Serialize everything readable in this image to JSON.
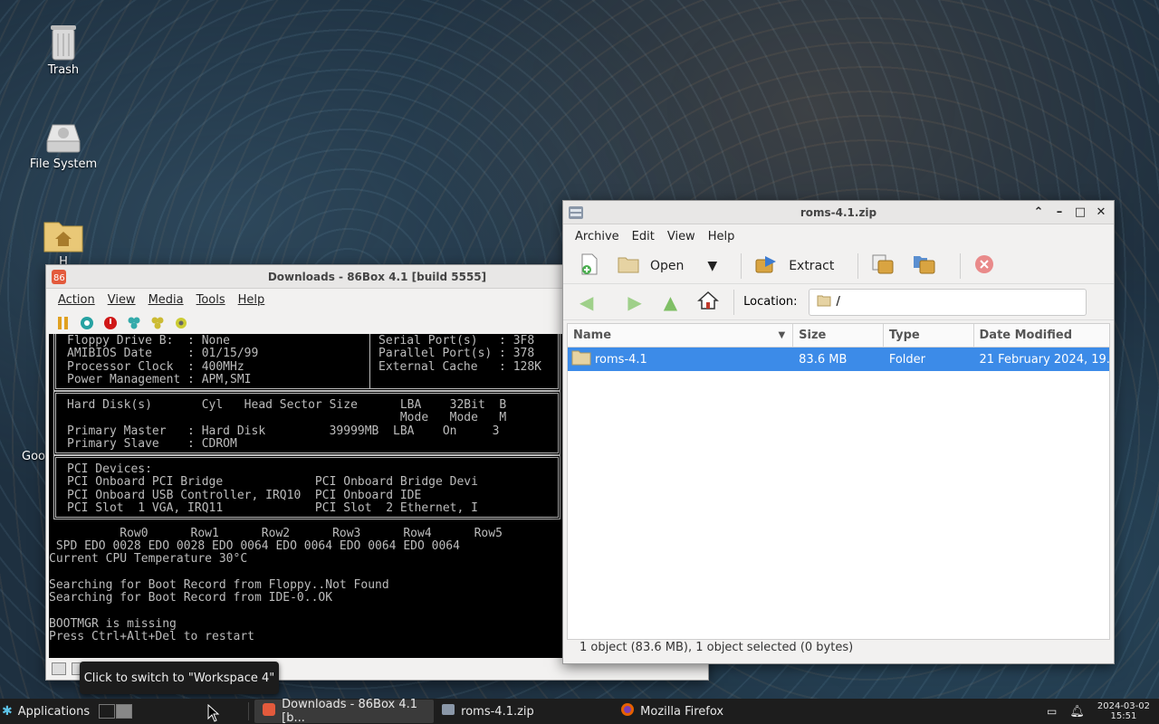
{
  "desktop": {
    "icons": [
      {
        "label": "Trash",
        "icon": "trash-icon"
      },
      {
        "label": "File System",
        "icon": "drive-icon"
      },
      {
        "label": "H",
        "icon": "home-folder-icon"
      },
      {
        "label": "Goo",
        "icon": "app-icon"
      }
    ]
  },
  "box86": {
    "title": "Downloads - 86Box 4.1 [build 5555]",
    "menu": [
      "Action",
      "View",
      "Media",
      "Tools",
      "Help"
    ],
    "toolbar_icons": [
      "pause-icon",
      "reset-icon",
      "power-icon",
      "ctrl-alt-del-icon",
      "ctrl-alt-esc-icon",
      "settings-icon"
    ],
    "screen": {
      "box1_left": "Floppy Drive B:  : None\nAMIBIOS Date     : 01/15/99\nProcessor Clock  : 400MHz\nPower Management : APM,SMI",
      "box1_right": "Serial Port(s)   : 3F8\nParallel Port(s) : 378\nExternal Cache   : 128K",
      "box2": "Hard Disk(s)       Cyl   Head Sector Size      LBA    32Bit  B\n                                               Mode   Mode   M\nPrimary Master   : Hard Disk         39999MB  LBA    On     3\nPrimary Slave    : CDROM",
      "box3": "PCI Devices:\nPCI Onboard PCI Bridge             PCI Onboard Bridge Devi\nPCI Onboard USB Controller, IRQ10  PCI Onboard IDE\nPCI Slot  1 VGA, IRQ11             PCI Slot  2 Ethernet, I",
      "rows_header": "          Row0      Row1      Row2      Row3      Row4      Row5",
      "spd_line": " SPD EDO 0028 EDO 0028 EDO 0064 EDO 0064 EDO 0064 EDO 0064",
      "cpu_temp": "Current CPU Temperature 30°C",
      "boot1": "Searching for Boot Record from Floppy..Not Found",
      "boot2": "Searching for Boot Record from IDE-0..OK",
      "err1": "BOOTMGR is missing",
      "err2": "Press Ctrl+Alt+Del to restart"
    }
  },
  "archive": {
    "title": "roms-4.1.zip",
    "menu": [
      "Archive",
      "Edit",
      "View",
      "Help"
    ],
    "toolbar": {
      "open": "Open",
      "extract": "Extract"
    },
    "location_label": "Location:",
    "location_value": "/",
    "columns": [
      "Name",
      "Size",
      "Type",
      "Date Modified"
    ],
    "rows": [
      {
        "name": "roms-4.1",
        "size": "83.6 MB",
        "type": "Folder",
        "modified": "21 February 2024, 19..."
      }
    ],
    "status": "1 object (83.6 MB), 1 object selected (0 bytes)"
  },
  "tooltip": "Click to switch to \"Workspace 4\"",
  "taskbar": {
    "apps_label": "Applications",
    "tasks": [
      {
        "label": "Downloads - 86Box 4.1 [b...",
        "icon": "86box-icon"
      },
      {
        "label": "roms-4.1.zip",
        "icon": "archive-icon"
      },
      {
        "label": "Mozilla Firefox",
        "icon": "firefox-icon"
      }
    ],
    "date": "2024-03-02",
    "time": "15:51"
  }
}
